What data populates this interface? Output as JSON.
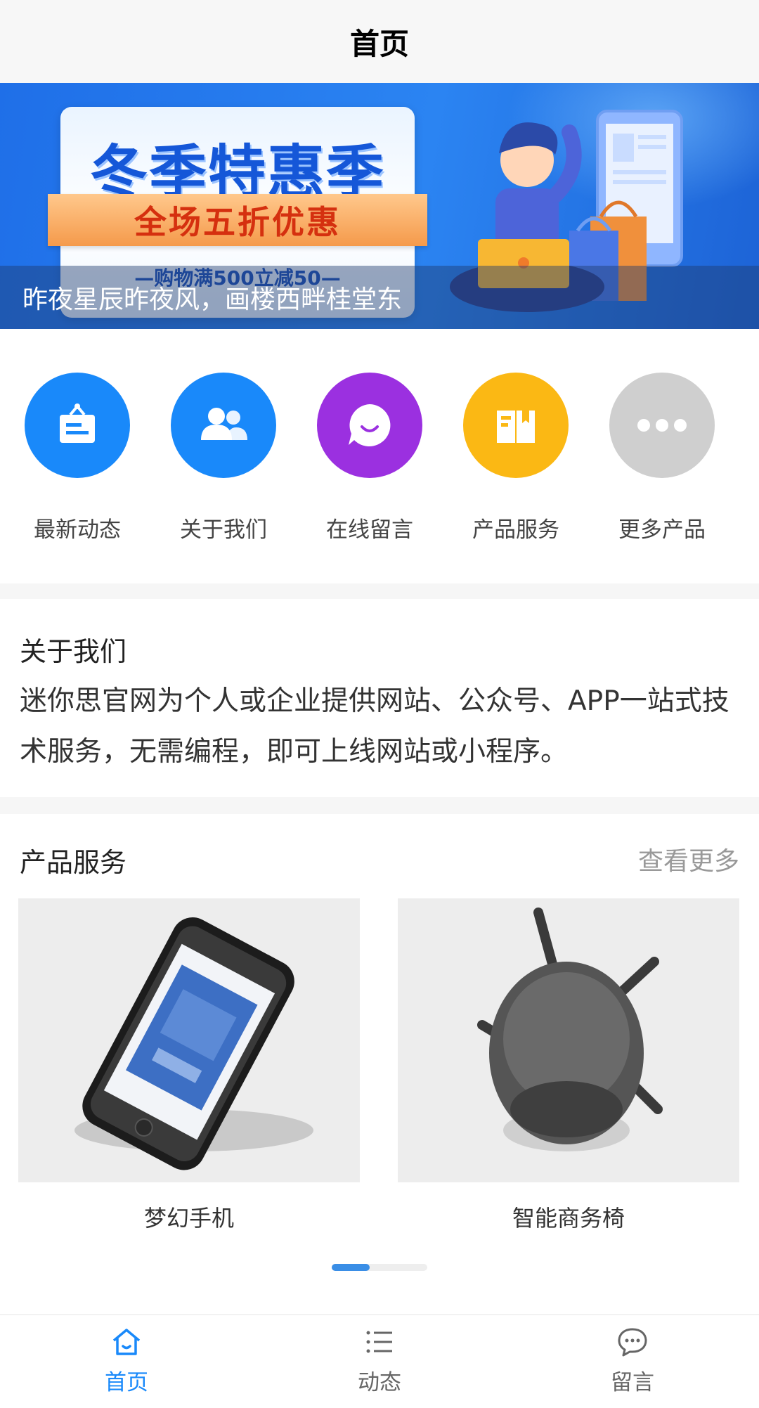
{
  "navbar": {
    "title": "首页"
  },
  "banner": {
    "promo_title": "冬季特惠季",
    "promo_ribbon": "全场五折优惠",
    "promo_sub": "—购物满500立减50—",
    "caption": "昨夜星辰昨夜风，画楼西畔桂堂东"
  },
  "menu": {
    "items": [
      {
        "label": "最新动态",
        "icon": "notice-board-icon",
        "color": "#1989fa"
      },
      {
        "label": "关于我们",
        "icon": "users-icon",
        "color": "#1989fa"
      },
      {
        "label": "在线留言",
        "icon": "chat-bubble-icon",
        "color": "#9b30e0"
      },
      {
        "label": "产品服务",
        "icon": "book-icon",
        "color": "#fbb814"
      },
      {
        "label": "更多产品",
        "icon": "more-dots-icon",
        "color": "#cfcfcf"
      }
    ]
  },
  "about": {
    "title": "关于我们",
    "description": "迷你思官网为个人或企业提供网站、公众号、APP一站式技术服务，无需编程，即可上线网站或小程序。"
  },
  "products": {
    "title": "产品服务",
    "more": "查看更多",
    "items": [
      {
        "name": "梦幻手机"
      },
      {
        "name": "智能商务椅"
      }
    ]
  },
  "tabbar": {
    "items": [
      {
        "label": "首页",
        "icon": "home-icon",
        "active": true
      },
      {
        "label": "动态",
        "icon": "list-icon",
        "active": false
      },
      {
        "label": "留言",
        "icon": "message-icon",
        "active": false
      }
    ],
    "active_color": "#1989fa",
    "inactive_color": "#666666"
  }
}
